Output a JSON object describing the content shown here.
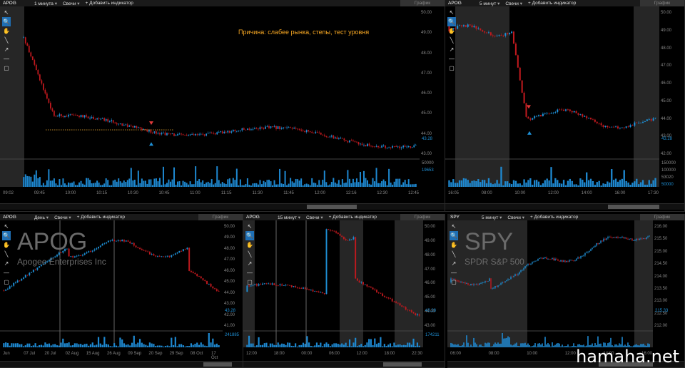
{
  "panels": [
    {
      "id": "p1",
      "symbol": "APOG",
      "interval": "1 минута",
      "type": "Свечи",
      "add": "+ Добавить индикатор",
      "grafik": "График",
      "yTicks": [
        "50.00",
        "49.00",
        "48.00",
        "47.00",
        "46.00",
        "45.00",
        "44.00",
        "43.00"
      ],
      "priceLast": "43.28",
      "volTicks": [
        "50000",
        "19653"
      ],
      "xTicks": [
        "09:02",
        "09:45",
        "10:00",
        "10:15",
        "10:30",
        "10:45",
        "11:00",
        "11:15",
        "11:30",
        "11:45",
        "12:00",
        "12:16",
        "12:30",
        "12:45"
      ],
      "annotation": "Причина: слабее рынка, степы, тест уровня"
    },
    {
      "id": "p2",
      "symbol": "APOG",
      "interval": "5 минут",
      "type": "Свечи",
      "add": "+ Добавить индикатор",
      "grafik": "График",
      "yTicks": [
        "50.00",
        "49.00",
        "48.00",
        "47.00",
        "46.00",
        "45.00",
        "44.00",
        "43.00",
        "42.00"
      ],
      "priceLast": "43.28",
      "volTicks": [
        "150000",
        "100000",
        "53020",
        "50000"
      ],
      "xTicks": [
        "16:05",
        "08:00",
        "10:00",
        "12:00",
        "14:00",
        "16:00",
        "17:30"
      ]
    },
    {
      "id": "p3",
      "symbol": "APOG",
      "interval": "День",
      "type": "Свечи",
      "add": "+ Добавить индикатор",
      "grafik": "График",
      "yTicks": [
        "50.00",
        "49.00",
        "48.00",
        "47.00",
        "46.00",
        "45.00",
        "44.00",
        "43.00",
        "42.00",
        "41.00"
      ],
      "priceLast": "43.28",
      "volTicks": [
        "241885"
      ],
      "xTicks": [
        "Jun",
        "07 Jul",
        "20 Jul",
        "02 Aug",
        "15 Aug",
        "26 Aug",
        "09 Sep",
        "20 Sep",
        "29 Sep",
        "08 Oct",
        "17 Oct"
      ],
      "watermark": "APOG",
      "watermarkSub": "Apogee Enterprises Inc"
    },
    {
      "id": "p4",
      "symbol": "APOG",
      "interval": "15 минут",
      "type": "Свечи",
      "add": "+ Добавить индикатор",
      "grafik": "График",
      "yTicks": [
        "50.00",
        "49.00",
        "48.00",
        "47.00",
        "46.00",
        "45.00",
        "44.00",
        "43.00"
      ],
      "priceLast": "43.28",
      "volTicks": [
        "174211"
      ],
      "xTicks": [
        "12:00",
        "18:00",
        "00:00",
        "06:00",
        "12:00",
        "18:00",
        "22:30"
      ]
    },
    {
      "id": "p5",
      "symbol": "SPY",
      "interval": "5 минут",
      "type": "Свечи",
      "add": "+ Добавить индикатор",
      "grafik": "График",
      "yTicks": [
        "216.00",
        "215.50",
        "215.00",
        "214.50",
        "214.00",
        "213.50",
        "213.00",
        "212.50",
        "212.00"
      ],
      "priceLast": "215.33",
      "volTicks": [],
      "xTicks": [
        "06:00",
        "08:00",
        "10:00",
        "12:00",
        "14:00",
        "16:00"
      ],
      "watermark": "SPY",
      "watermarkSub": "SPDR S&P 500"
    }
  ],
  "tools": [
    {
      "icon": "cursor-icon",
      "glyph": "↖"
    },
    {
      "icon": "zoom-icon",
      "glyph": "🔍"
    },
    {
      "icon": "hand-icon",
      "glyph": "✋"
    },
    {
      "icon": "line-icon",
      "glyph": "╲"
    },
    {
      "icon": "arrow-icon",
      "glyph": "↗"
    },
    {
      "icon": "hline-icon",
      "glyph": "—"
    },
    {
      "icon": "rect-icon",
      "glyph": "▢"
    }
  ],
  "site": "hamaha.net",
  "colors": {
    "up": "#1e90d6",
    "down": "#c0191e",
    "vol": "#1e88d0"
  }
}
